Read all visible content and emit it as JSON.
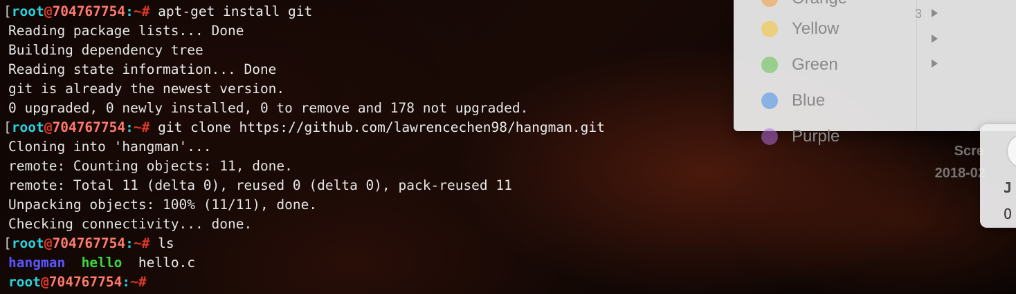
{
  "theme": {
    "prompt_user_color": "#2ad3de",
    "prompt_at_color": "#e23a28",
    "prompt_host_color": "#ff7a6e",
    "text_color": "#ececec",
    "dir_color": "#5a55ff",
    "exec_color": "#3dd644"
  },
  "terminal": {
    "prompt": {
      "bracket": "[",
      "user": "root",
      "at": "@",
      "host": "704767754",
      "colon": ":",
      "path": "~",
      "symbol": "#"
    },
    "lines": [
      {
        "type": "prompt",
        "bracket": true,
        "command": "apt-get install git"
      },
      {
        "type": "output",
        "text": "Reading package lists... Done"
      },
      {
        "type": "output",
        "text": "Building dependency tree"
      },
      {
        "type": "output",
        "text": "Reading state information... Done"
      },
      {
        "type": "output",
        "text": "git is already the newest version."
      },
      {
        "type": "output",
        "text": "0 upgraded, 0 newly installed, 0 to remove and 178 not upgraded."
      },
      {
        "type": "prompt",
        "bracket": true,
        "command": "git clone https://github.com/lawrencechen98/hangman.git"
      },
      {
        "type": "output",
        "text": "Cloning into 'hangman'..."
      },
      {
        "type": "output",
        "text": "remote: Counting objects: 11, done."
      },
      {
        "type": "output",
        "text": "remote: Total 11 (delta 0), reused 0 (delta 0), pack-reused 11"
      },
      {
        "type": "output",
        "text": "Unpacking objects: 100% (11/11), done."
      },
      {
        "type": "output",
        "text": "Checking connectivity... done."
      },
      {
        "type": "prompt",
        "bracket": true,
        "command": "ls"
      },
      {
        "type": "ls",
        "entries": [
          {
            "name": "hangman",
            "kind": "dir"
          },
          {
            "name": "hello",
            "kind": "exec"
          },
          {
            "name": "hello.c",
            "kind": "file"
          }
        ]
      },
      {
        "type": "prompt",
        "bracket": false,
        "command": ""
      }
    ]
  },
  "tags_menu": {
    "items": [
      {
        "label": "Orange",
        "color": "#f39a3a"
      },
      {
        "label": "Yellow",
        "color": "#f4c52e"
      },
      {
        "label": "Green",
        "color": "#5fc14a"
      },
      {
        "label": "Blue",
        "color": "#3f8ee8"
      },
      {
        "label": "Purple",
        "color": "#b06bd8"
      }
    ],
    "stray_text": "3"
  },
  "desktop": {
    "screenshot_label_1": "Scre",
    "screenshot_label_2": "2018-02"
  },
  "notification": {
    "line1": "J",
    "line2": "O"
  }
}
